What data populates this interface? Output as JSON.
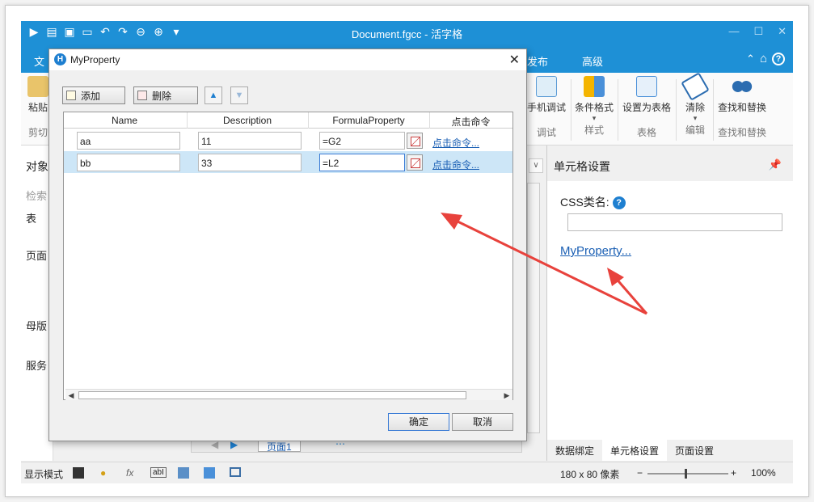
{
  "titlebar": {
    "title": "Document.fgcc - 活字格"
  },
  "menubar": {
    "file_tab": "文",
    "publish_tab": "发布",
    "advanced_tab": "高级"
  },
  "ribbon": {
    "paste": "粘贴",
    "clipboard": "剪切",
    "mobile_debug": "手机调试",
    "debug": "调试",
    "cond_format": "条件格式",
    "style": "样式",
    "set_table": "设置为表格",
    "table": "表格",
    "clear": "清除",
    "edit": "编辑",
    "find_replace": "查找和替换",
    "find_replace_group": "查找和替换"
  },
  "leftpanel": {
    "objects": "对象",
    "search": "检索",
    "table": "表",
    "page": "页面",
    "master": "母版",
    "service": "服务"
  },
  "rightpanel": {
    "title": "单元格设置",
    "css_label": "CSS类名:",
    "myproperty_link": "MyProperty...",
    "tabs": [
      "数据绑定",
      "单元格设置",
      "页面设置"
    ]
  },
  "sheetbar": {
    "page_tab": "页面1"
  },
  "statusbar": {
    "display_mode": "显示模式",
    "size": "180 x 80 像素",
    "zoom": "100%"
  },
  "dialog": {
    "title": "MyProperty",
    "add_label": "添加",
    "delete_label": "删除",
    "columns": [
      "Name",
      "Description",
      "FormulaProperty",
      "点击命令"
    ],
    "rows": [
      {
        "name": "aa",
        "description": "11",
        "formula": "=G2",
        "command": "点击命令..."
      },
      {
        "name": "bb",
        "description": "33",
        "formula": "=L2",
        "command": "点击命令..."
      }
    ],
    "ok_label": "确定",
    "cancel_label": "取消"
  },
  "colors": {
    "accent": "#1e90d6",
    "annotation_arrow": "#e8423c"
  }
}
